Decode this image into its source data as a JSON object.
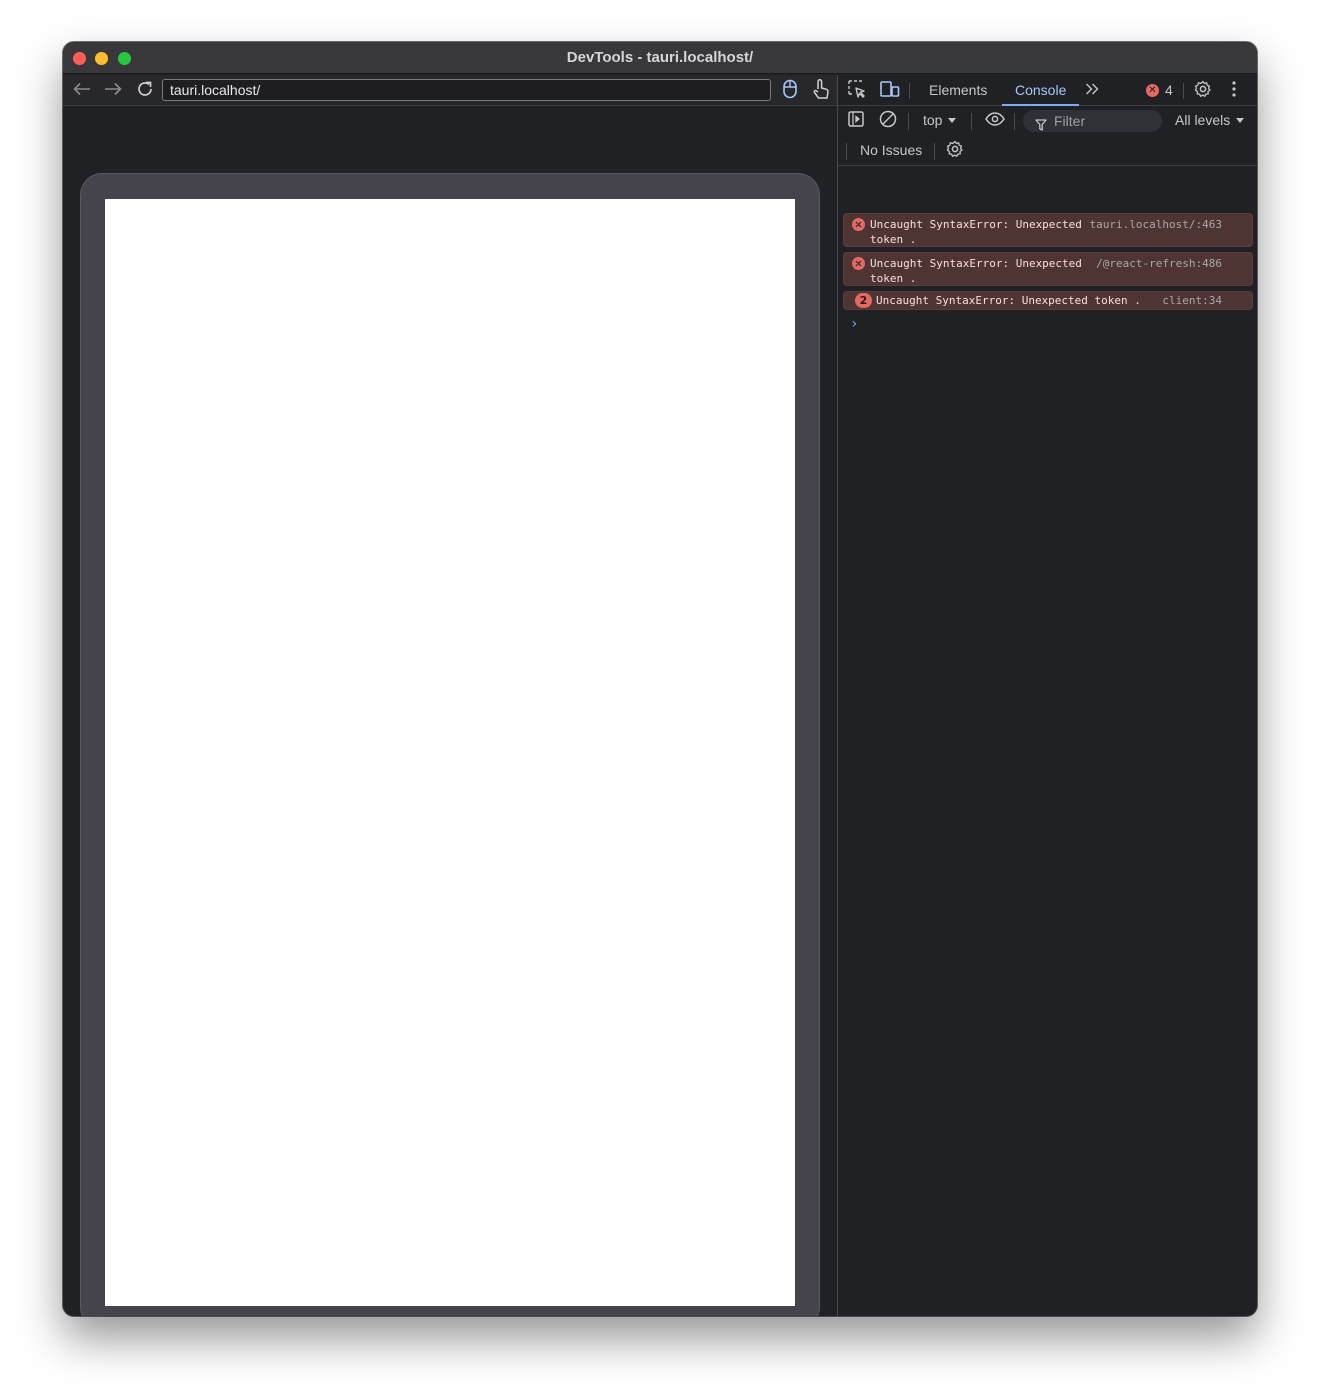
{
  "window": {
    "title": "DevTools - tauri.localhost/"
  },
  "browser": {
    "url": "tauri.localhost/",
    "icons": [
      "back-arrow-icon",
      "forward-arrow-icon",
      "reload-icon",
      "mouse-icon",
      "touch-icon"
    ]
  },
  "devtools": {
    "tabs": [
      {
        "label": "Elements",
        "active": false
      },
      {
        "label": "Console",
        "active": true
      }
    ],
    "error_count": "4",
    "toolbar": {
      "context": "top",
      "filter_placeholder": "Filter",
      "levels": "All levels"
    },
    "issues_label": "No Issues",
    "messages": [
      {
        "text": "Uncaught SyntaxError: Unexpected\ntoken .",
        "source": "tauri.localhost/:463",
        "count": null
      },
      {
        "text": "Uncaught SyntaxError: Unexpected\ntoken .",
        "source": "/@react-refresh:486",
        "count": null
      },
      {
        "text": "Uncaught SyntaxError: Unexpected token .",
        "source": "client:34",
        "count": "2"
      }
    ],
    "prompt_symbol": "›"
  },
  "colors": {
    "error_accent": "#e46962",
    "error_background": "#4e3534",
    "active_tab": "#a8c7fa",
    "panel_background": "#202124",
    "device_frame": "#45444c"
  }
}
